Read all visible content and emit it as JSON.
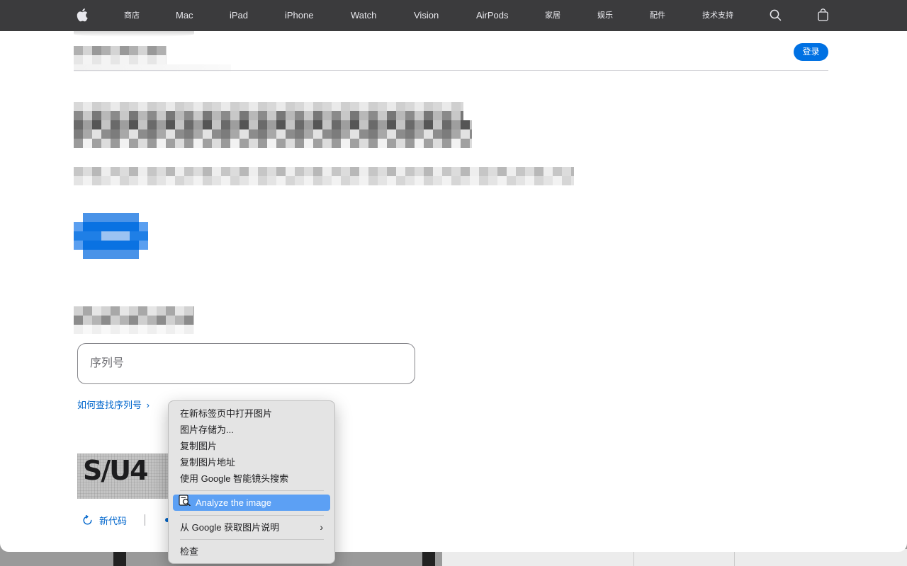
{
  "nav": {
    "apple_logo": "apple-logo-icon",
    "items": [
      "商店",
      "Mac",
      "iPad",
      "iPhone",
      "Watch",
      "Vision",
      "AirPods",
      "家居",
      "娱乐",
      "配件",
      "技术支持"
    ],
    "search_icon": "search-icon",
    "bag_icon": "shopping-bag-icon"
  },
  "subnav": {
    "signin_label": "登录"
  },
  "form": {
    "serial_placeholder": "序列号",
    "find_serial_link": "如何查找序列号",
    "find_serial_chevron": "›",
    "captcha_text": "S/U4",
    "refresh_label": "新代码"
  },
  "context_menu": {
    "items": [
      "在新标签页中打开图片",
      "图片存储为...",
      "复制图片",
      "复制图片地址",
      "使用 Google 智能镜头搜索",
      "Analyze the image",
      "从 Google 获取图片说明",
      "检查"
    ],
    "chevron": "›"
  },
  "colors": {
    "nav_bg": "#3b3b3d",
    "accent_blue": "#0071e3",
    "link_blue": "#0066cc",
    "menu_highlight": "#5ca0f4"
  }
}
